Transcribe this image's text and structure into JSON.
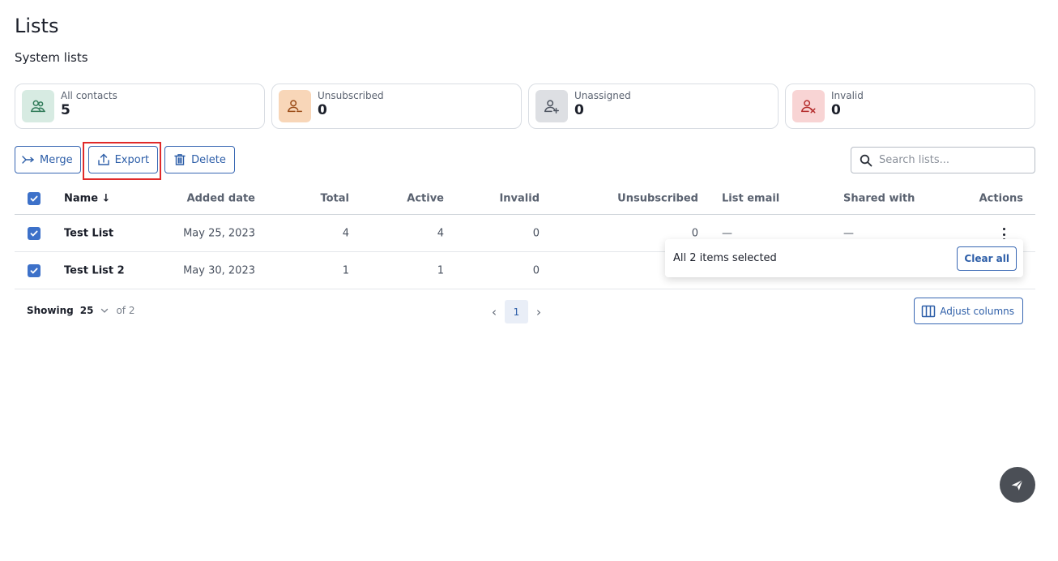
{
  "page": {
    "title": "Lists",
    "section": "System lists"
  },
  "cards": [
    {
      "label": "All contacts",
      "value": "5",
      "icon": "contacts-icon",
      "bg": "#d7ebe2",
      "fg": "#2f7a58"
    },
    {
      "label": "Unsubscribed",
      "value": "0",
      "icon": "user-minus-icon",
      "bg": "#f8d6b8",
      "fg": "#9a4b16"
    },
    {
      "label": "Unassigned",
      "value": "0",
      "icon": "user-plus-icon",
      "bg": "#dddfe3",
      "fg": "#4d5460"
    },
    {
      "label": "Invalid",
      "value": "0",
      "icon": "user-x-icon",
      "bg": "#f8d4d4",
      "fg": "#b42b2b"
    }
  ],
  "toolbar": {
    "merge": "Merge",
    "export": "Export",
    "delete": "Delete"
  },
  "search": {
    "placeholder": "Search lists..."
  },
  "table": {
    "columns": [
      "Name ↓",
      "Added date",
      "Total",
      "Active",
      "Invalid",
      "Unsubscribed",
      "List email",
      "Shared with",
      "Actions"
    ],
    "rows": [
      {
        "name": "Test List",
        "date": "May 25, 2023",
        "total": "4",
        "active": "4",
        "invalid": "0",
        "unsub": "0",
        "email": "—",
        "shared": "—"
      },
      {
        "name": "Test List 2",
        "date": "May 30, 2023",
        "total": "1",
        "active": "1",
        "invalid": "0",
        "unsub": "",
        "email": "",
        "shared": ""
      }
    ]
  },
  "selection": {
    "text": "All 2 items selected",
    "clear": "Clear all"
  },
  "footer": {
    "showing": "Showing",
    "per_page": "25",
    "of": "of 2",
    "page": "1",
    "adjust": "Adjust columns"
  },
  "colors": {
    "accent": "#3d71c9",
    "highlight": "#e02a2a"
  }
}
